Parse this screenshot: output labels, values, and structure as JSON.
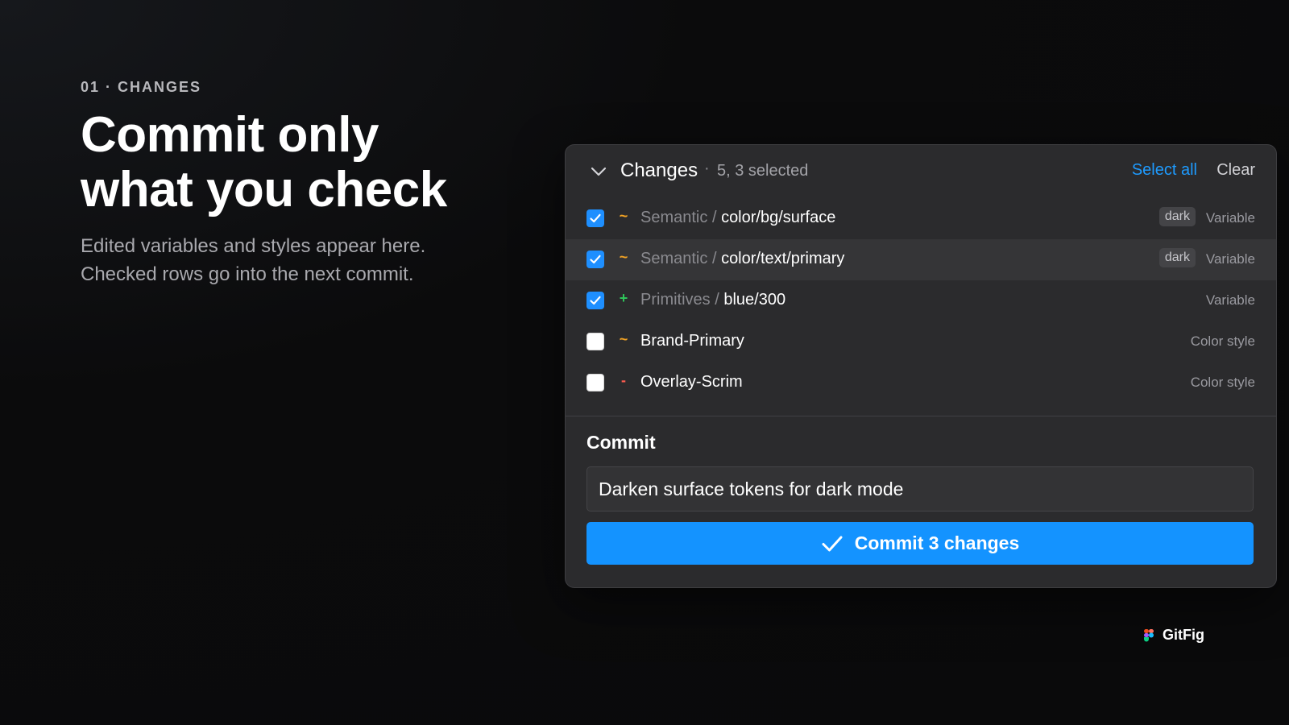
{
  "intro": {
    "eyebrow": "01 · CHANGES",
    "headline": "Commit only what you check",
    "subcopy": "Edited variables and styles appear here. Checked rows go into the next commit."
  },
  "panel": {
    "title": "Changes",
    "separator": "·",
    "count": "5, 3 selected",
    "select_all": "Select all",
    "clear": "Clear",
    "rows": [
      {
        "checked": true,
        "status": "~",
        "group": "Semantic",
        "separator": "/",
        "token": "color/bg/surface",
        "badge": "dark",
        "kind": "Variable"
      },
      {
        "checked": true,
        "status": "~",
        "group": "Semantic",
        "separator": "/",
        "token": "color/text/primary",
        "badge": "dark",
        "kind": "Variable"
      },
      {
        "checked": true,
        "status": "+",
        "group": "Primitives",
        "separator": "/",
        "token": "blue/300",
        "badge": "",
        "kind": "Variable"
      },
      {
        "checked": false,
        "status": "~",
        "group": "",
        "separator": "",
        "token": "Brand-Primary",
        "badge": "",
        "kind": "Color style"
      },
      {
        "checked": false,
        "status": "-",
        "group": "",
        "separator": "",
        "token": "Overlay-Scrim",
        "badge": "",
        "kind": "Color style"
      }
    ]
  },
  "commit": {
    "heading": "Commit",
    "message": "Darken surface tokens for dark mode",
    "button_label": "Commit 3 changes"
  },
  "brand": {
    "name": "GitFig",
    "logo_icon": "figma-logo-icon"
  },
  "icons": {
    "collapse": "chevron-down-icon",
    "checkbox_checked": "checkmark-icon",
    "commit_button": "checkmark-icon"
  },
  "colors": {
    "background": "#0b0b0c",
    "panel": "#2b2b2d",
    "accent": "#1493ff",
    "link": "#1e9bff",
    "modified": "#f2a324",
    "added": "#2fc45a",
    "deleted": "#ff5b4f"
  }
}
